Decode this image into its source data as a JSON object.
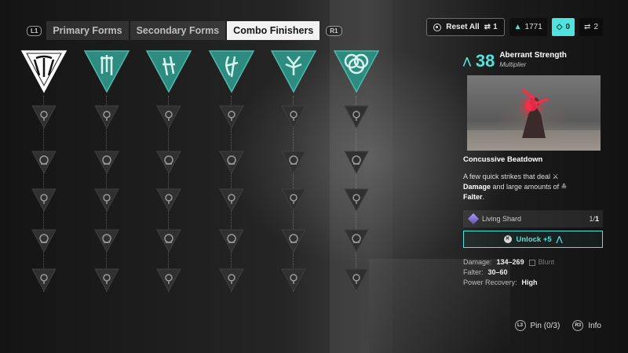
{
  "tabs": {
    "left_hint": "L1",
    "right_hint": "R1",
    "items": [
      {
        "label": "Primary Forms",
        "active": false
      },
      {
        "label": "Secondary Forms",
        "active": false
      },
      {
        "label": "Combo Finishers",
        "active": true
      }
    ]
  },
  "top_right": {
    "reset_label": "Reset All",
    "reset_count": "1",
    "currency_a": "1771",
    "currency_b": "0",
    "currency_c": "2"
  },
  "tree": {
    "columns": [
      {
        "head_icon": "claw-mark-icon",
        "selected": true,
        "nodes": [
          "helmet-skull-icon",
          "round-skull-icon",
          "spike-helm-icon",
          "arrow-up-icon",
          "trophy-icon"
        ]
      },
      {
        "head_icon": "banner-drip-icon",
        "selected": false,
        "nodes": [
          "stacked-orb-icon",
          "dollar-coin-icon",
          "helmet-up-icon",
          "arrow-up-icon",
          "crossed-blades-icon"
        ]
      },
      {
        "head_icon": "twin-blades-icon",
        "selected": false,
        "nodes": [
          "layers-icon",
          "skull-plus-icon",
          "branch-icon",
          "ring-icon",
          "sword-icon"
        ]
      },
      {
        "head_icon": "blade-staff-icon",
        "selected": false,
        "nodes": [
          "swirl-icon",
          "fist-burst-icon",
          "skull-drop-icon",
          "shield-icon",
          "infinity-icon"
        ]
      },
      {
        "head_icon": "antler-icon",
        "selected": false,
        "nodes": [
          "skull-cross-icon",
          "ring-shield-icon",
          "burst-icon",
          "spiked-ring-icon",
          "target-icon"
        ]
      },
      {
        "head_icon": "triple-circle-icon",
        "selected": false,
        "nodes": [
          "helmet-drop-icon",
          "cycle-icon",
          "spiked-crown-icon",
          "ring-small-icon",
          "drop-icon"
        ]
      }
    ]
  },
  "detail": {
    "level": "38",
    "name": "Aberrant Strength",
    "subtitle": "Multiplier",
    "section_title": "Concussive Beatdown",
    "desc_pre": "A few quick strikes that deal",
    "desc_damage": "Damage",
    "desc_mid": "and large amounts of",
    "desc_falter": "Falter",
    "desc_end": ".",
    "cost_label": "Living Shard",
    "cost_have": "1/",
    "cost_need": "1",
    "unlock_label": "Unlock +5",
    "damage_label": "Damage:",
    "damage_value": "134–269",
    "damage_type": "Blunt",
    "falter_label": "Falter:",
    "falter_value": "30–60",
    "power_label": "Power Recovery:",
    "power_value": "High"
  },
  "bottom": {
    "pin_hint": "L3",
    "pin_label": "Pin (0/3)",
    "info_hint": "R3",
    "info_label": "Info"
  },
  "colors": {
    "accent": "#4fe3df",
    "tree_teal": "#2d8c7f",
    "node_dark": "#303030"
  }
}
